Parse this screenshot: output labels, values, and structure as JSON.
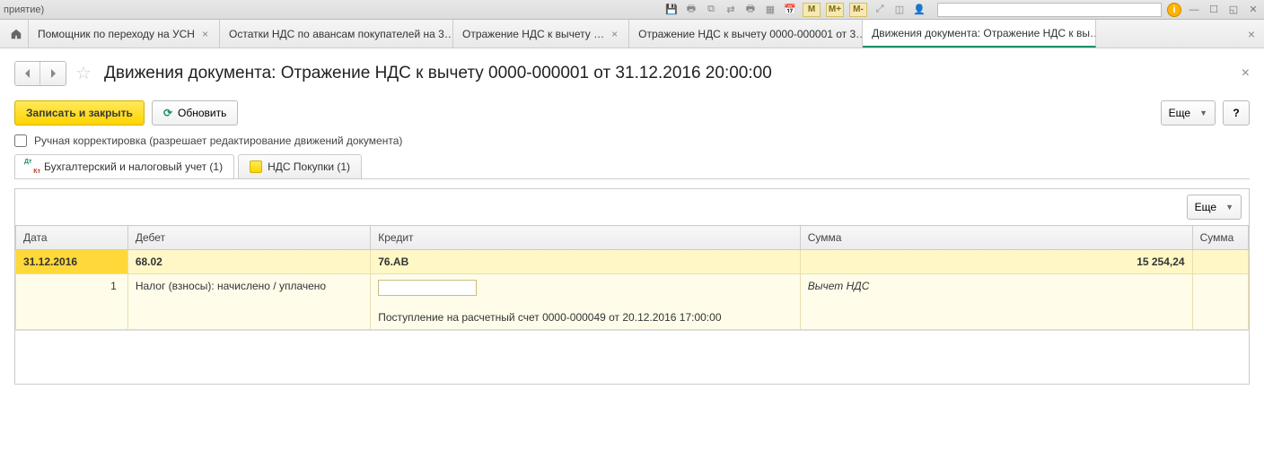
{
  "sysbar": {
    "caption": "приятие)",
    "m_buttons": [
      "M",
      "M+",
      "M-"
    ]
  },
  "tabs": [
    {
      "label": "Помощник по переходу на УСН"
    },
    {
      "label": "Остатки НДС по авансам покупателей на 3…"
    },
    {
      "label": "Отражение НДС к вычету …"
    },
    {
      "label": "Отражение НДС к вычету 0000-000001 от 3…"
    },
    {
      "label": "Движения документа: Отражение НДС к вы…",
      "active": true
    }
  ],
  "page_title": "Движения документа: Отражение НДС к вычету 0000-000001 от 31.12.2016 20:00:00",
  "buttons": {
    "save_close": "Записать и закрыть",
    "refresh": "Обновить",
    "more": "Еще",
    "help": "?"
  },
  "manual_edit_label": "Ручная корректировка (разрешает редактирование движений документа)",
  "subtabs": [
    {
      "label": "Бухгалтерский и налоговый учет (1)",
      "icon": "dtkt",
      "active": true
    },
    {
      "label": "НДС Покупки (1)",
      "icon": "doc"
    }
  ],
  "grid": {
    "more": "Еще",
    "headers": {
      "date": "Дата",
      "debit": "Дебет",
      "credit": "Кредит",
      "sum": "Сумма",
      "sum2": "Сумма"
    },
    "row": {
      "date": "31.12.2016",
      "debit": "68.02",
      "credit": "76.АВ",
      "sum": "15 254,24",
      "num": "1",
      "debit_desc": "Налог (взносы): начислено / уплачено",
      "credit_desc": "Поступление на расчетный счет 0000-000049 от 20.12.2016 17:00:00",
      "sum_desc": "Вычет НДС"
    }
  }
}
